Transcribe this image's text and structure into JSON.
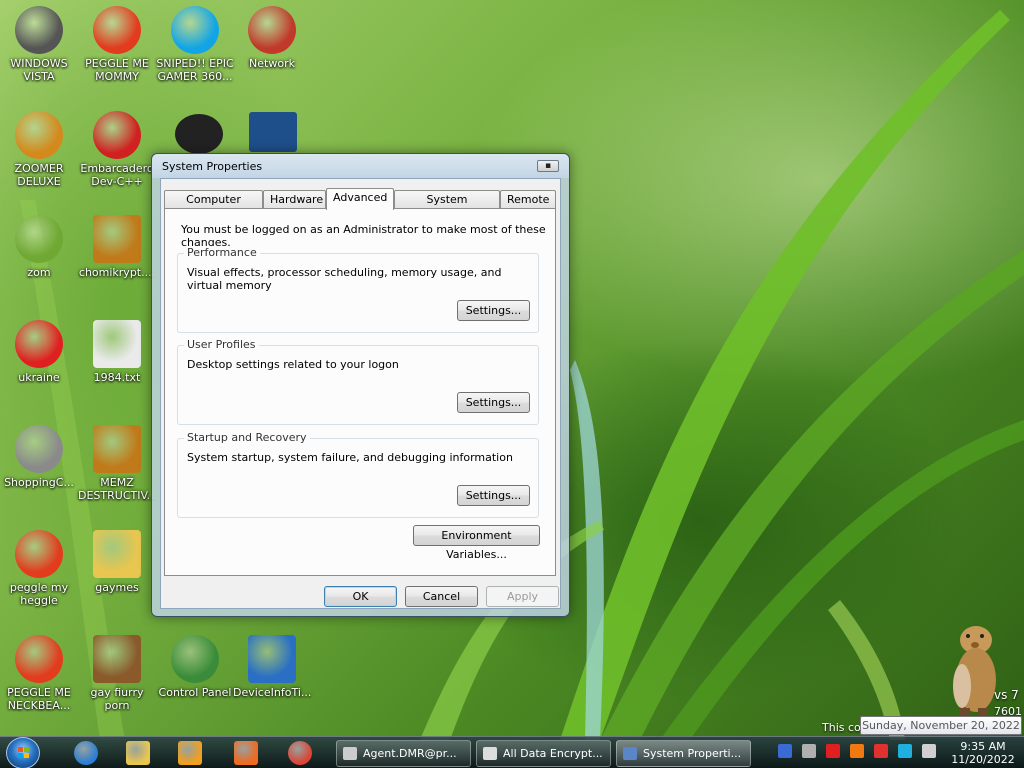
{
  "desktop": {
    "icons": [
      {
        "label": "WINDOWS VISTA",
        "icon": "bowl-icon",
        "color": "#555555"
      },
      {
        "label": "PEGGLE ME MOMMY",
        "icon": "peggle-icon",
        "color": "#e23b1e"
      },
      {
        "label": "SNIPED!! EPIC GAMER 360...",
        "icon": "skype-icon",
        "color": "#12a5e6"
      },
      {
        "label": "Network",
        "icon": "network-icon",
        "color": "#c0392b"
      },
      {
        "label": "ZOOMER DELUXE",
        "icon": "zuma-icon",
        "color": "#d4891c"
      },
      {
        "label": "Embarcadero Dev-C++",
        "icon": "devcpp-icon",
        "color": "#d0201f"
      },
      {
        "label": "zom",
        "icon": "flower-icon",
        "color": "#6fa832"
      },
      {
        "label": "chomikrypt....",
        "icon": "clock-file-icon",
        "color": "#c07a1a"
      },
      {
        "label": "ukraine",
        "icon": "radiation-icon",
        "color": "#e02020"
      },
      {
        "label": "1984.txt",
        "icon": "text-file-icon",
        "color": "#eaeaea"
      },
      {
        "label": "ShoppingC...",
        "icon": "flash-icon",
        "color": "#8a8a8a"
      },
      {
        "label": "MEMZ DESTRUCTIV...",
        "icon": "clock-file-icon",
        "color": "#c07a1a"
      },
      {
        "label": "peggle my heggle",
        "icon": "peggle-icon",
        "color": "#e23b1e"
      },
      {
        "label": "gaymes",
        "icon": "folder-icon",
        "color": "#e8c650"
      },
      {
        "label": "PEGGLE ME NECKBEA...",
        "icon": "peggle-icon",
        "color": "#e23b1e"
      },
      {
        "label": "gay fiurry porn",
        "icon": "beaver-box-icon",
        "color": "#8a5a2b"
      },
      {
        "label": "Control Panel",
        "icon": "control-panel-icon",
        "color": "#3a8c3a"
      },
      {
        "label": "DeviceInfoTi...",
        "icon": "monitor-info-icon",
        "color": "#2a6fc4"
      }
    ],
    "hidden_icons": [
      {
        "label": "",
        "icon": "dark-disc-icon",
        "color": "#222222"
      },
      {
        "label": "",
        "icon": "monitor-icon",
        "color": "#1f4f8a"
      }
    ],
    "watermark_line1": "vs 7",
    "watermark_line2": "7601",
    "watermark_line3": "This co"
  },
  "dialog": {
    "title": "System Properties",
    "close_glyph": "▪",
    "tabs": [
      "Computer Name",
      "Hardware",
      "Advanced",
      "System Protection",
      "Remote"
    ],
    "active_tab": "Advanced",
    "notice": "You must be logged on as an Administrator to make most of these changes.",
    "groups": [
      {
        "title": "Performance",
        "description": "Visual effects, processor scheduling, memory usage, and virtual memory",
        "button": "Settings..."
      },
      {
        "title": "User Profiles",
        "description": "Desktop settings related to your logon",
        "button": "Settings..."
      },
      {
        "title": "Startup and Recovery",
        "description": "System startup, system failure, and debugging information",
        "button": "Settings..."
      }
    ],
    "env_button": "Environment Variables...",
    "ok": "OK",
    "cancel": "Cancel",
    "apply": "Apply"
  },
  "taskbar": {
    "tasks": [
      {
        "label": "Agent.DMR@pr...",
        "icon": "terminal-icon",
        "color": "#cccccc"
      },
      {
        "label": "All Data Encrypt...",
        "icon": "window-icon",
        "color": "#dddddd"
      },
      {
        "label": "System Properti...",
        "icon": "system-properties-icon",
        "color": "#5a86c8"
      }
    ],
    "quick_launch": [
      {
        "icon": "ie-icon",
        "color": "#2a7fd4"
      },
      {
        "icon": "explorer-icon",
        "color": "#e8c650"
      },
      {
        "icon": "media-player-icon",
        "color": "#f0a020"
      },
      {
        "icon": "paint-icon",
        "color": "#f06a20"
      },
      {
        "icon": "chrome-icon",
        "color": "#dd4433"
      }
    ],
    "tray": [
      {
        "icon": "shield-tray-icon",
        "color": "#3a6ad4"
      },
      {
        "icon": "network-tray-icon",
        "color": "#b0b0b0"
      },
      {
        "icon": "check-tray-icon",
        "color": "#e02020"
      },
      {
        "icon": "search-tray-icon",
        "color": "#f07a10"
      },
      {
        "icon": "flag-tray-icon",
        "color": "#e03030"
      },
      {
        "icon": "monitor-tray-icon",
        "color": "#20b0e0"
      },
      {
        "icon": "volume-tray-icon",
        "color": "#d0d0d0"
      }
    ],
    "time": "9:35 AM",
    "date": "11/20/2022",
    "tooltip": "Sunday, November 20, 2022"
  }
}
